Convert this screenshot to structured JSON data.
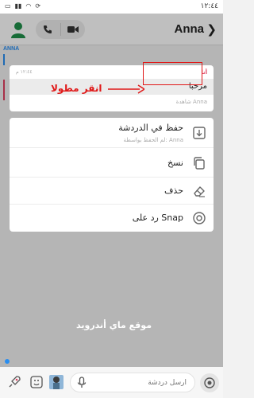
{
  "status_bar": {
    "time": "١٢:٤٤"
  },
  "header": {
    "title": "Anna",
    "back_glyph": "❯"
  },
  "chat": {
    "sender_label": "ANNA"
  },
  "message": {
    "sender": "أنا",
    "time": "١٢:٤٤ م",
    "text": "مرحبا",
    "seen": "شاهدة Anna"
  },
  "annotation": {
    "text": "انقر مطولا",
    "color": "#e01818"
  },
  "menu": {
    "items": [
      {
        "label": "حفظ في الدردشة",
        "sublabel": "لم الحفظ بواسطة: Anna",
        "icon": "save-chat-icon"
      },
      {
        "label": "نسخ",
        "icon": "copy-icon"
      },
      {
        "label": "حذف",
        "icon": "eraser-icon"
      },
      {
        "label": "رد على Snap",
        "icon": "camera-icon"
      }
    ]
  },
  "watermark": "موقع ماي أندرويد",
  "composer": {
    "placeholder": "أرسل دردشة"
  },
  "colors": {
    "accent_blue": "#2a8ef0",
    "me_red": "#e04060",
    "highlight_red": "#e01818",
    "friend_green": "#1f8f4a"
  }
}
